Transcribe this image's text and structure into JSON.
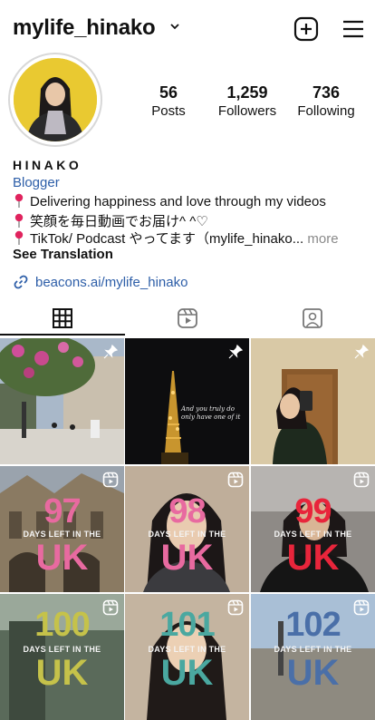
{
  "header": {
    "username": "mylife_hinako",
    "icons": {
      "dropdown": "chevron-down-icon",
      "create": "plus-square-icon",
      "menu": "hamburger-menu-icon"
    }
  },
  "profile": {
    "stats": [
      {
        "value": "56",
        "label": "Posts"
      },
      {
        "value": "1,259",
        "label": "Followers"
      },
      {
        "value": "736",
        "label": "Following"
      }
    ],
    "name": "HINAKO",
    "category": "Blogger",
    "bio": [
      "Delivering happiness and love through my videos",
      "笑顔を毎日動画でお届け^ ^♡",
      "TikTok/ Podcast やってます（mylife_hinako..."
    ],
    "more_label": "more",
    "see_translation": "See Translation",
    "link": "beacons.ai/mylife_hinako"
  },
  "tabs": [
    {
      "name": "posts",
      "icon": "grid-icon",
      "selected": true
    },
    {
      "name": "reels",
      "icon": "reels-icon",
      "selected": false
    },
    {
      "name": "tagged",
      "icon": "tagged-person-icon",
      "selected": false
    }
  ],
  "posts": [
    {
      "type": "photo",
      "pinned": true,
      "desc": "flowers street"
    },
    {
      "type": "photo",
      "pinned": true,
      "overlay": "And you truly do only have one of it"
    },
    {
      "type": "photo",
      "pinned": true,
      "desc": "mirror selfie"
    },
    {
      "type": "reel",
      "number": "97",
      "subtitle": "DAYS LEFT IN THE",
      "country": "UK"
    },
    {
      "type": "reel",
      "number": "98",
      "subtitle": "DAYS LEFT IN THE",
      "country": "UK"
    },
    {
      "type": "reel",
      "number": "99",
      "subtitle": "DAYS LEFT IN THE",
      "country": "UK"
    },
    {
      "type": "reel",
      "number": "100",
      "subtitle": "DAYS LEFT IN THE",
      "country": "UK"
    },
    {
      "type": "reel",
      "number": "101",
      "subtitle": "DAYS LEFT IN THE",
      "country": "UK"
    },
    {
      "type": "reel",
      "number": "102",
      "subtitle": "DAYS LEFT IN THE",
      "country": "UK"
    }
  ],
  "colors": {
    "link": "#2d5ea8",
    "pin": "#e0245e",
    "pink": "#e86aa0",
    "red": "#e8253b",
    "olive": "#c5c24a",
    "teal": "#4aa8a0",
    "steel": "#4a6fa8"
  }
}
